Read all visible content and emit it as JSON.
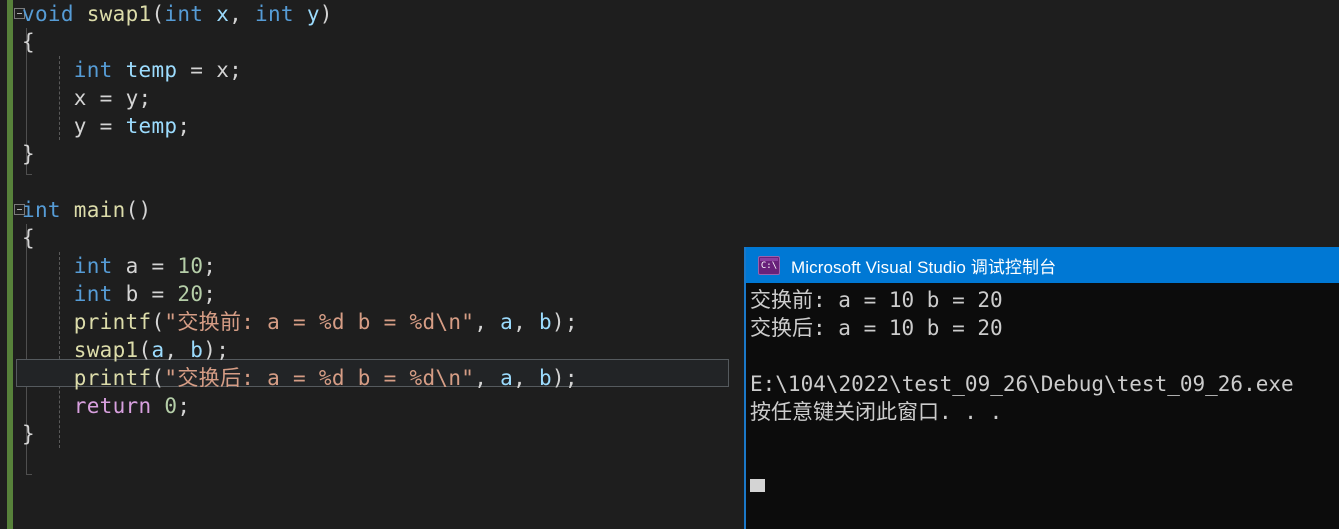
{
  "editor": {
    "name": "visual-studio-code-editor",
    "background": "#1e1e1e",
    "change_bar_color": "#57813a",
    "lines": [
      {
        "n": 1,
        "segments": [
          {
            "t": "void",
            "c": "kw"
          },
          {
            "t": " ",
            "c": "plain"
          },
          {
            "t": "swap1",
            "c": "fn"
          },
          {
            "t": "(",
            "c": "punc"
          },
          {
            "t": "int",
            "c": "kw"
          },
          {
            "t": " ",
            "c": "plain"
          },
          {
            "t": "x",
            "c": "var"
          },
          {
            "t": ", ",
            "c": "punc"
          },
          {
            "t": "int",
            "c": "kw"
          },
          {
            "t": " ",
            "c": "plain"
          },
          {
            "t": "y",
            "c": "var"
          },
          {
            "t": ")",
            "c": "punc"
          }
        ]
      },
      {
        "n": 2,
        "segments": [
          {
            "t": "{",
            "c": "plain"
          }
        ]
      },
      {
        "n": 3,
        "segments": [
          {
            "t": "    ",
            "c": "plain"
          },
          {
            "t": "int",
            "c": "kw"
          },
          {
            "t": " ",
            "c": "plain"
          },
          {
            "t": "temp",
            "c": "var"
          },
          {
            "t": " = ",
            "c": "plain"
          },
          {
            "t": "x",
            "c": "plain"
          },
          {
            "t": ";",
            "c": "plain"
          }
        ]
      },
      {
        "n": 4,
        "segments": [
          {
            "t": "    ",
            "c": "plain"
          },
          {
            "t": "x",
            "c": "plain"
          },
          {
            "t": " = ",
            "c": "plain"
          },
          {
            "t": "y",
            "c": "plain"
          },
          {
            "t": ";",
            "c": "plain"
          }
        ]
      },
      {
        "n": 5,
        "segments": [
          {
            "t": "    ",
            "c": "plain"
          },
          {
            "t": "y",
            "c": "plain"
          },
          {
            "t": " = ",
            "c": "plain"
          },
          {
            "t": "temp",
            "c": "var"
          },
          {
            "t": ";",
            "c": "plain"
          }
        ]
      },
      {
        "n": 6,
        "segments": [
          {
            "t": "}",
            "c": "plain"
          }
        ]
      },
      {
        "n": 7,
        "segments": []
      },
      {
        "n": 8,
        "segments": [
          {
            "t": "int",
            "c": "kw"
          },
          {
            "t": " ",
            "c": "plain"
          },
          {
            "t": "main",
            "c": "fn"
          },
          {
            "t": "()",
            "c": "punc"
          }
        ]
      },
      {
        "n": 9,
        "segments": [
          {
            "t": "{",
            "c": "plain"
          }
        ]
      },
      {
        "n": 10,
        "segments": [
          {
            "t": "    ",
            "c": "plain"
          },
          {
            "t": "int",
            "c": "kw"
          },
          {
            "t": " ",
            "c": "plain"
          },
          {
            "t": "a",
            "c": "plain"
          },
          {
            "t": " = ",
            "c": "plain"
          },
          {
            "t": "10",
            "c": "num"
          },
          {
            "t": ";",
            "c": "plain"
          }
        ]
      },
      {
        "n": 11,
        "segments": [
          {
            "t": "    ",
            "c": "plain"
          },
          {
            "t": "int",
            "c": "kw"
          },
          {
            "t": " ",
            "c": "plain"
          },
          {
            "t": "b",
            "c": "plain"
          },
          {
            "t": " = ",
            "c": "plain"
          },
          {
            "t": "20",
            "c": "num"
          },
          {
            "t": ";",
            "c": "plain"
          }
        ]
      },
      {
        "n": 12,
        "segments": [
          {
            "t": "    ",
            "c": "plain"
          },
          {
            "t": "printf",
            "c": "fn"
          },
          {
            "t": "(",
            "c": "punc"
          },
          {
            "t": "\"交换前: a = %d b = %d\\n\"",
            "c": "str"
          },
          {
            "t": ", ",
            "c": "punc"
          },
          {
            "t": "a",
            "c": "var"
          },
          {
            "t": ", ",
            "c": "punc"
          },
          {
            "t": "b",
            "c": "var"
          },
          {
            "t": ");",
            "c": "punc"
          }
        ]
      },
      {
        "n": 13,
        "segments": [
          {
            "t": "    ",
            "c": "plain"
          },
          {
            "t": "swap1",
            "c": "fn"
          },
          {
            "t": "(",
            "c": "punc"
          },
          {
            "t": "a",
            "c": "var"
          },
          {
            "t": ", ",
            "c": "punc"
          },
          {
            "t": "b",
            "c": "var"
          },
          {
            "t": ");",
            "c": "punc"
          }
        ],
        "current": true
      },
      {
        "n": 14,
        "segments": [
          {
            "t": "    ",
            "c": "plain"
          },
          {
            "t": "printf",
            "c": "fn"
          },
          {
            "t": "(",
            "c": "punc"
          },
          {
            "t": "\"交换后: a = %d b = %d\\n\"",
            "c": "str"
          },
          {
            "t": ", ",
            "c": "punc"
          },
          {
            "t": "a",
            "c": "var"
          },
          {
            "t": ", ",
            "c": "punc"
          },
          {
            "t": "b",
            "c": "var"
          },
          {
            "t": ");",
            "c": "punc"
          }
        ]
      },
      {
        "n": 15,
        "segments": [
          {
            "t": "    ",
            "c": "plain"
          },
          {
            "t": "return",
            "c": "ret"
          },
          {
            "t": " ",
            "c": "plain"
          },
          {
            "t": "0",
            "c": "num"
          },
          {
            "t": ";",
            "c": "plain"
          }
        ]
      },
      {
        "n": 16,
        "segments": [
          {
            "t": "}",
            "c": "plain"
          }
        ]
      }
    ],
    "fold_markers": [
      {
        "line": 1,
        "state": "expanded"
      },
      {
        "line": 8,
        "state": "expanded"
      }
    ]
  },
  "console": {
    "name": "debug-console-window",
    "title": "Microsoft Visual Studio 调试控制台",
    "icon": "console-window-icon",
    "icon_text": "C:\\",
    "titlebar_color": "#0078d4",
    "background": "#0c0c0c",
    "text_color": "#cccccc",
    "output": [
      "交换前: a = 10 b = 20",
      "交换后: a = 10 b = 20",
      "",
      "E:\\104\\2022\\test_09_26\\Debug\\test_09_26.exe",
      "按任意键关闭此窗口. . ."
    ],
    "cursor": "block-caret"
  }
}
